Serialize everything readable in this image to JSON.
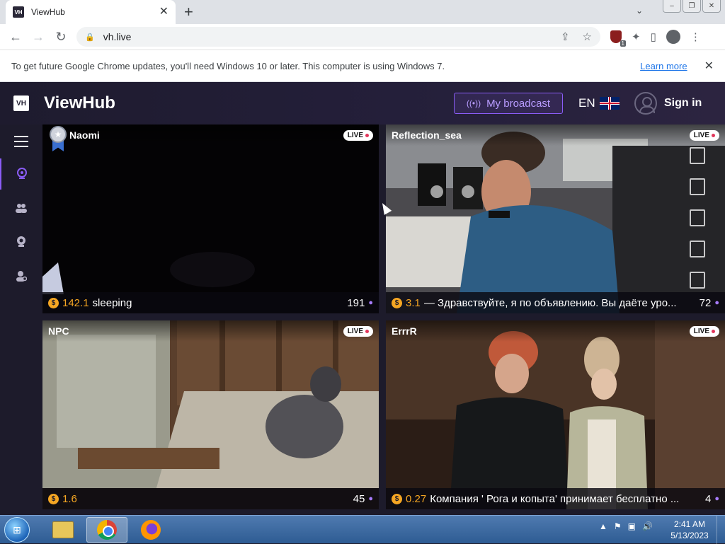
{
  "browser": {
    "tab_favicon": "VH",
    "tab_title": "ViewHub",
    "tab_close": "✕",
    "new_tab": "+",
    "tab_search_icon": "⌄",
    "win_controls": [
      "–",
      "❐",
      "✕"
    ],
    "back_icon": "←",
    "forward_icon": "→",
    "reload_icon": "↻",
    "lock_icon": "🔒",
    "url": "vh.live",
    "share_icon": "⇪",
    "star_icon": "☆",
    "extension_badge": "1",
    "puzzle_icon": "✦",
    "sidepanel_icon": "▯",
    "menu_icon": "⋮"
  },
  "infobar": {
    "message": "To get future Google Chrome updates, you'll need Windows 10 or later. This computer is using Windows 7.",
    "link": "Learn more",
    "close": "✕"
  },
  "site": {
    "logo_mark": "VH",
    "logo_text": "ViewHub",
    "broadcast_icon": "((•))",
    "broadcast_label": "My broadcast",
    "language": "EN",
    "signin_label": "Sign in",
    "sidebar_icons": [
      "menu-icon",
      "webcam-icon",
      "users-icon",
      "shield-icon",
      "profile-icon"
    ],
    "accent_color": "#8a5cf6",
    "coin_color": "#f5a623"
  },
  "streams": [
    {
      "name": "Naomi",
      "live": "LIVE",
      "coin": "$",
      "tokens": "142.1",
      "topic": "sleeping",
      "viewers": "191",
      "badge": "medal-icon"
    },
    {
      "name": "Reflection_sea",
      "live": "LIVE",
      "coin": "$",
      "tokens": "3.1",
      "topic": "— Здравствуйте, я по объявлению. Вы даёте уро...",
      "viewers": "72"
    },
    {
      "name": "NPC",
      "live": "LIVE",
      "coin": "$",
      "tokens": "1.6",
      "topic": "",
      "viewers": "45"
    },
    {
      "name": "ErrrR",
      "live": "LIVE",
      "coin": "$",
      "tokens": "0.27",
      "topic": "Компания ' Рога и копыта' принимает бесплатно ...",
      "viewers": "4"
    }
  ],
  "taskbar": {
    "start_icon": "⊞",
    "apps": [
      "explorer-icon",
      "chrome-icon",
      "firefox-icon"
    ],
    "tray": [
      "▲",
      "⚑",
      "▣",
      "🔊"
    ],
    "time": "2:41 AM",
    "date": "5/13/2023"
  }
}
